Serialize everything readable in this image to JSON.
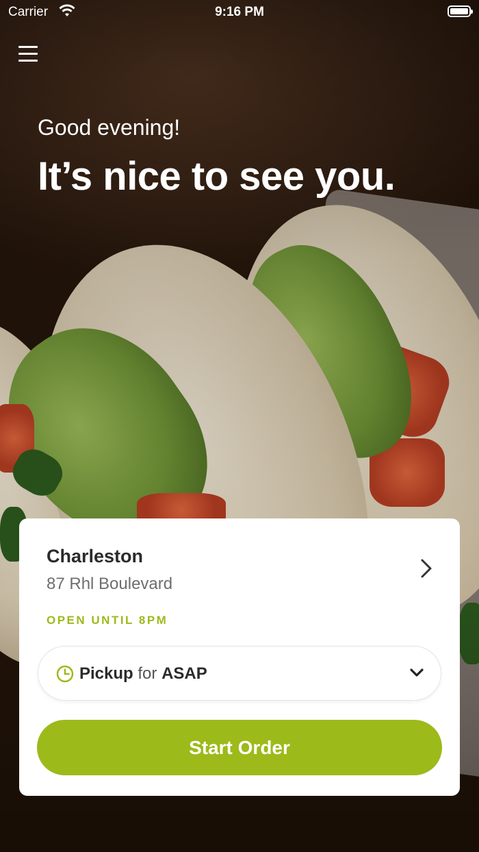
{
  "status_bar": {
    "carrier": "Carrier",
    "time": "9:16 PM"
  },
  "hero": {
    "greeting": "Good evening!",
    "headline": "It’s nice to see you."
  },
  "location": {
    "name": "Charleston",
    "address": "87 Rhl Boulevard",
    "hours": "OPEN UNTIL 8PM"
  },
  "order_mode": {
    "mode": "Pickup",
    "connector": "for",
    "time": "ASAP"
  },
  "actions": {
    "start_order": "Start Order"
  },
  "colors": {
    "accent": "#9cba1a",
    "text_primary": "#2b2b2b",
    "text_secondary": "#6e6e6e"
  },
  "icons": {
    "menu": "hamburger-icon",
    "location_chevron": "chevron-right-icon",
    "pickup_time": "clock-icon",
    "dropdown": "chevron-down-icon",
    "wifi": "wifi-icon",
    "battery": "battery-icon"
  }
}
